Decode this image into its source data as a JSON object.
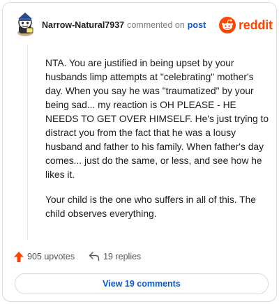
{
  "comment": {
    "author": "Narrow-Natural7937",
    "action_text": "commented on",
    "target_link": "post",
    "paragraphs": [
      "NTA. You are justified in being upset by your husbands limp attempts at \"celebrating\" mother's day. When you say he was \"traumatized\" by your being sad... my reaction is OH PLEASE - HE NEEDS TO GET OVER HIMSELF. He's just trying to distract you from the fact that he was a lousy husband and father to his family. When father's day comes... just do the same, or less, and see how he likes it.",
      "Your child is the one who suffers in all of this. The child observes everything."
    ],
    "upvotes": "905 upvotes",
    "replies": "19 replies",
    "view_button": "View 19 comments"
  },
  "brand": {
    "logo_text": "reddit",
    "accent": "#ff4500",
    "link_color": "#0a58ca"
  },
  "icons": {
    "avatar": "avatar-icon",
    "logo": "reddit-alien-icon",
    "upvote": "upvote-arrow-icon",
    "reply": "reply-arrow-icon"
  }
}
